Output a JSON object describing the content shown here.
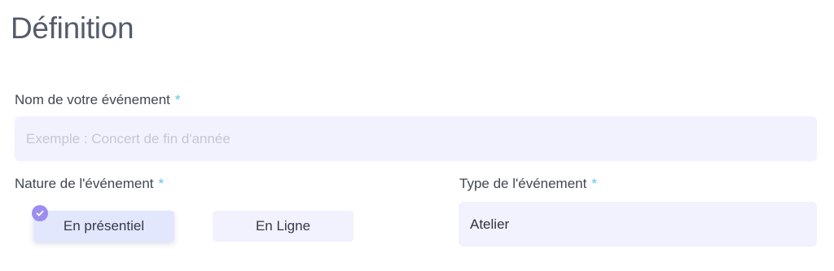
{
  "section": {
    "title": "Définition"
  },
  "event_name": {
    "label": "Nom de votre événement",
    "required_mark": "*",
    "placeholder": "Exemple : Concert de fin d'année",
    "value": ""
  },
  "event_nature": {
    "label": "Nature de l'événement",
    "required_mark": "*",
    "options": [
      {
        "label": "En présentiel",
        "selected": true
      },
      {
        "label": "En Ligne",
        "selected": false
      }
    ],
    "selected_icon": "check-circle-icon"
  },
  "event_type": {
    "label": "Type de l'événement",
    "required_mark": "*",
    "value": "Atelier"
  },
  "colors": {
    "accent": "#9d8df0",
    "required": "#5ac8d8",
    "field_background": "#f2f1fe",
    "selected_option_background": "#e3e7fd"
  }
}
